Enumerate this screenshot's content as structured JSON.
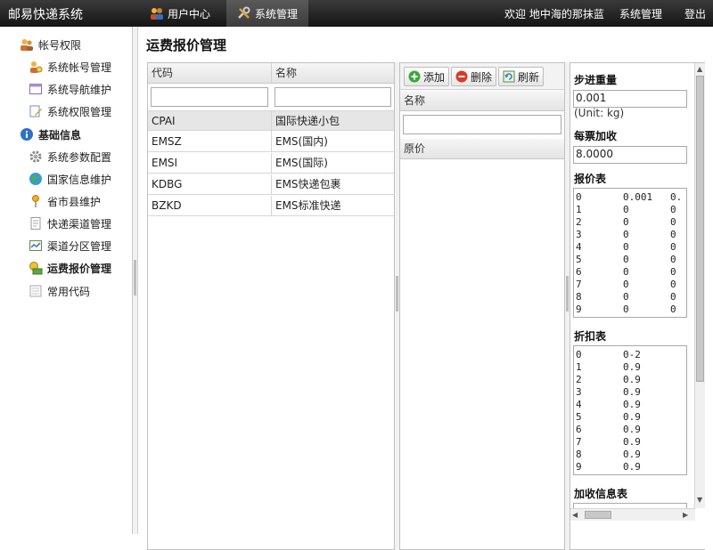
{
  "app": {
    "title": "邮易快递系统",
    "tabs": [
      {
        "label": "用户中心",
        "icon": "users-icon"
      },
      {
        "label": "系统管理",
        "icon": "tools-icon"
      }
    ],
    "welcome": "欢迎 地中海的那抹蓝",
    "system_link": "系统管理",
    "logout": "登出"
  },
  "sidebar": {
    "groups": [
      {
        "label": "帐号权限",
        "icon": "users-icon",
        "items": [
          {
            "label": "系统帐号管理",
            "icon": "user-icon"
          },
          {
            "label": "系统导航维护",
            "icon": "window-icon"
          },
          {
            "label": "系统权限管理",
            "icon": "edit-icon"
          }
        ]
      },
      {
        "label": "基础信息",
        "icon": "info-icon",
        "items": [
          {
            "label": "系统参数配置",
            "icon": "gear-icon"
          },
          {
            "label": "国家信息维护",
            "icon": "globe-icon"
          },
          {
            "label": "省市县维护",
            "icon": "pin-icon"
          },
          {
            "label": "快递渠道管理",
            "icon": "document-icon"
          },
          {
            "label": "渠道分区管理",
            "icon": "chart-icon"
          },
          {
            "label": "运费报价管理",
            "icon": "money-icon"
          },
          {
            "label": "常用代码",
            "icon": "code-icon"
          }
        ]
      }
    ]
  },
  "page": {
    "title": "运费报价管理"
  },
  "channel_grid": {
    "columns": [
      "代码",
      "名称"
    ],
    "rows": [
      {
        "code": "CPAI",
        "name": "国际快递小包"
      },
      {
        "code": "EMSZ",
        "name": "EMS(国内)"
      },
      {
        "code": "EMSI",
        "name": "EMS(国际)"
      },
      {
        "code": "KDBG",
        "name": "EMS快递包裹"
      },
      {
        "code": "BZKD",
        "name": "EMS标准快递"
      }
    ]
  },
  "zone_panel": {
    "add_label": "添加",
    "delete_label": "删除",
    "refresh_label": "刷新",
    "name_header": "名称",
    "price_header": "原价"
  },
  "quote_form": {
    "step_weight_label": "步进重量",
    "step_weight_value": "0.001",
    "unit_text": "(Unit: kg)",
    "per_ticket_label": "每票加收",
    "per_ticket_value": "8.0000",
    "quote_table_label": "报价表",
    "quote_table_lines": [
      "0       0.001   0.",
      "1       0       0",
      "2       0       0",
      "3       0       0",
      "4       0       0",
      "5       0       0",
      "6       0       0",
      "7       0       0",
      "8       0       0",
      "9       0       0"
    ],
    "discount_table_label": "折扣表",
    "discount_table_lines": [
      "0       0-2",
      "1       0.9",
      "2       0.9",
      "3       0.9",
      "4       0.9",
      "5       0.9",
      "6       0.9",
      "7       0.9",
      "8       0.9",
      "9       0.9"
    ],
    "surcharge_table_label": "加收信息表"
  }
}
